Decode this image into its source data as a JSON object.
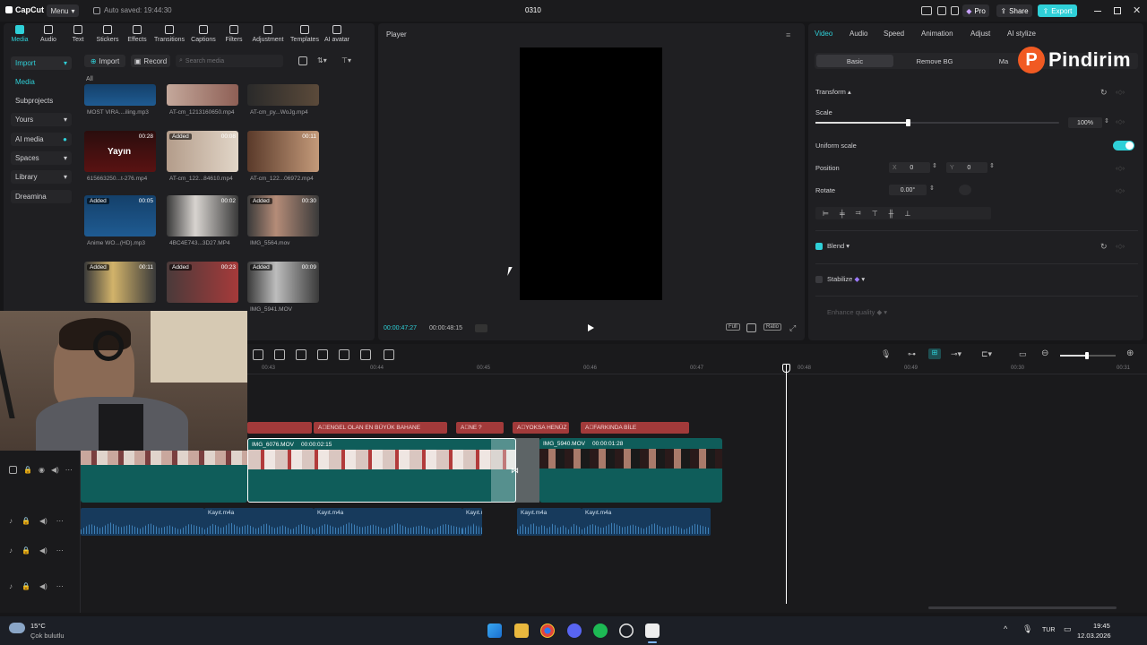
{
  "titlebar": {
    "app": "CapCut",
    "menu": "Menu",
    "autosave": "Auto saved: 19:44:30",
    "project": "0310",
    "pro": "Pro",
    "share": "Share",
    "export": "Export"
  },
  "toolbar": [
    {
      "label": "Media"
    },
    {
      "label": "Audio"
    },
    {
      "label": "Text"
    },
    {
      "label": "Stickers"
    },
    {
      "label": "Effects"
    },
    {
      "label": "Transitions"
    },
    {
      "label": "Captions"
    },
    {
      "label": "Filters"
    },
    {
      "label": "Adjustment"
    },
    {
      "label": "Templates"
    },
    {
      "label": "AI avatar"
    }
  ],
  "sidebar": {
    "import": "Import",
    "media": "Media",
    "subprojects": "Subprojects",
    "yours": "Yours",
    "ai_media": "AI media",
    "spaces": "Spaces",
    "library": "Library",
    "dreamina": "Dreamina"
  },
  "mediabar": {
    "import": "Import",
    "record": "Record",
    "search_placeholder": "Search media",
    "all": "All"
  },
  "media_items": [
    {
      "caption": "MOST VIRA....iling.mp3",
      "added": "",
      "dur": ""
    },
    {
      "caption": "AT-cm_1213160650.mp4",
      "added": "",
      "dur": ""
    },
    {
      "caption": "AT-cm_py...WoJg.mp4",
      "added": "",
      "dur": ""
    },
    {
      "caption": "615663250...t-276.mp4",
      "added": "",
      "dur": "00:28",
      "overlay": "Yayın"
    },
    {
      "caption": "AT-cm_122...84610.mp4",
      "added": "Added",
      "dur": "00:08"
    },
    {
      "caption": "AT-cm_122...06972.mp4",
      "added": "",
      "dur": "00:11"
    },
    {
      "caption": "Anime WO...(HD).mp3",
      "added": "Added",
      "dur": "00:05"
    },
    {
      "caption": "4BC4E743...3D27.MP4",
      "added": "",
      "dur": "00:02"
    },
    {
      "caption": "IMG_5564.mov",
      "added": "Added",
      "dur": "00:30"
    },
    {
      "caption": "",
      "added": "Added",
      "dur": "00:11"
    },
    {
      "caption": "",
      "added": "Added",
      "dur": "00:23"
    },
    {
      "caption": "IMG_5941.MOV",
      "added": "Added",
      "dur": "00:09"
    }
  ],
  "player": {
    "title": "Player",
    "current": "00:00:47:27",
    "total": "00:00:48:15",
    "full": "Full",
    "ratio": "Ratio"
  },
  "props": {
    "tabs": [
      "Video",
      "Audio",
      "Speed",
      "Animation",
      "Adjust",
      "AI stylize"
    ],
    "subtabs": [
      "Basic",
      "Remove BG",
      "Ma"
    ],
    "transform": "Transform",
    "scale": "Scale",
    "scale_value": "100%",
    "scale_fraction": 0.38,
    "uniform_scale": "Uniform scale",
    "position": "Position",
    "pos_x_label": "X",
    "pos_x": "0",
    "pos_y_label": "Y",
    "pos_y": "0",
    "rotate": "Rotate",
    "rotate_value": "0.00°",
    "blend": "Blend",
    "stabilize": "Stabilize",
    "enhance": "Enhance quality"
  },
  "watermark": "Pindirim",
  "timeline": {
    "ticks": [
      "00:43",
      "00:44",
      "00:45",
      "00:46",
      "00:47",
      "00:48",
      "00:49",
      "00:30",
      "00:31"
    ],
    "captions": [
      "ENGEL OLAN EN BÜYÜK BAHANE",
      "NE ?",
      "YOKSA HENÜZ",
      "FARKINDA BİLE"
    ],
    "clips": [
      {
        "name": "IMG_6076.MOV",
        "dur": "00:00:02:15"
      },
      {
        "name": "IMG_5940.MOV",
        "dur": "00:00:01:28"
      }
    ],
    "audio": [
      "Kayıt.m4a",
      "Kayıt.m4a",
      "Kayıt.m",
      "Kayıt.m4a",
      "Kayıt.m4a"
    ]
  },
  "taskbar": {
    "temp": "15°C",
    "weather": "Çok bulutlu",
    "lang": "TUR",
    "time": "19:45",
    "date": "12.03.2026"
  },
  "colors": {
    "accent": "#2fd0d8",
    "caption": "#a23a3a",
    "video": "#0f5d5a",
    "audio": "#173a5c",
    "watermark": "#f15a22"
  }
}
